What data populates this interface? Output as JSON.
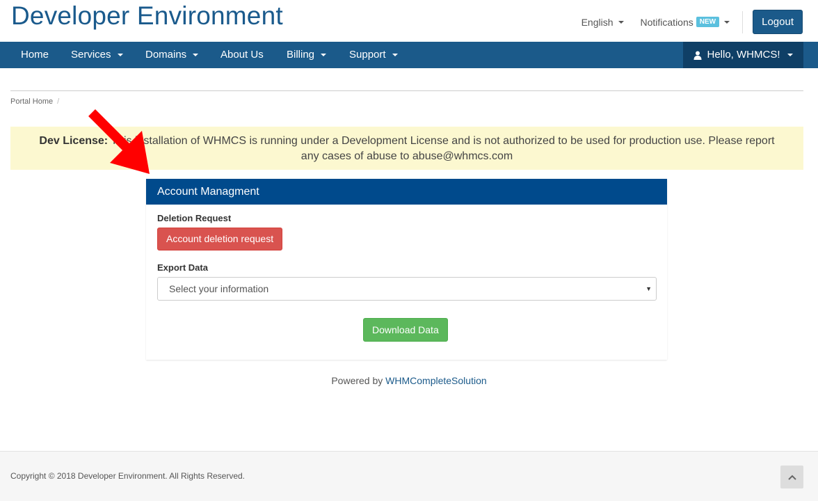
{
  "header": {
    "site_title": "Developer Environment",
    "language": "English",
    "notifications": "Notifications",
    "notifications_badge": "NEW",
    "logout": "Logout"
  },
  "nav": {
    "items": [
      {
        "label": "Home",
        "has_caret": false
      },
      {
        "label": "Services",
        "has_caret": true
      },
      {
        "label": "Domains",
        "has_caret": true
      },
      {
        "label": "About Us",
        "has_caret": false
      },
      {
        "label": "Billing",
        "has_caret": true
      },
      {
        "label": "Support",
        "has_caret": true
      }
    ],
    "user_menu": "Hello, WHMCS!"
  },
  "breadcrumb": {
    "home": "Portal Home",
    "separator": "/"
  },
  "alert": {
    "bold": "Dev License:",
    "text": " This installation of WHMCS is running under a Development License and is not authorized to be used for production use. Please report any cases of abuse to abuse@whmcs.com"
  },
  "panel": {
    "title": "Account Managment",
    "deletion_label": "Deletion Request",
    "deletion_button": "Account deletion request",
    "export_label": "Export Data",
    "export_select_value": "Select your information",
    "download_button": "Download Data"
  },
  "powered": {
    "prefix": "Powered by ",
    "link": "WHMCompleteSolution"
  },
  "footer": {
    "copyright": "Copyright © 2018 Developer Environment. All Rights Reserved."
  },
  "colors": {
    "brand": "#1b5a8a",
    "panel_header": "#004a8c",
    "danger": "#d9534f",
    "success": "#5cb85c",
    "alert_bg": "#fcf8d0",
    "annotation_arrow": "#ff0000"
  },
  "icons": {
    "user": "user-icon",
    "back_to_top": "chevron-up-icon",
    "annotation": "red-arrow-annotation"
  }
}
